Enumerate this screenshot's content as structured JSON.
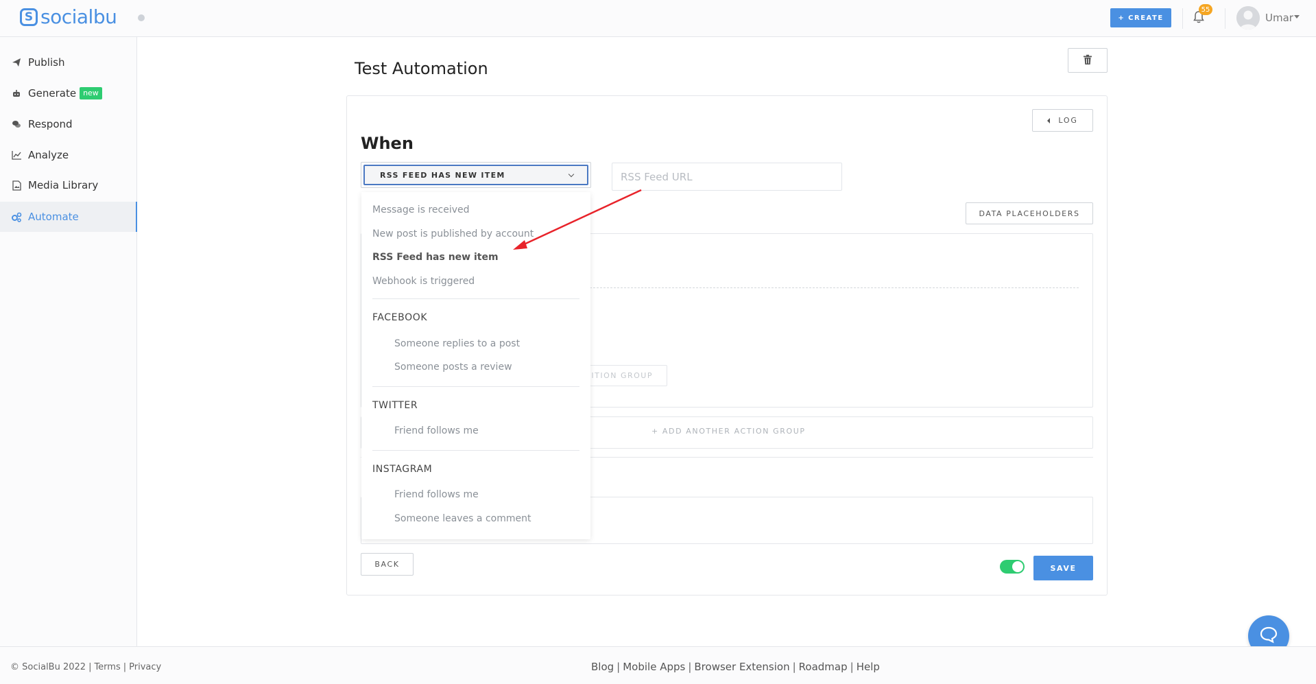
{
  "header": {
    "brand": "socialbu",
    "create_label": "+ CREATE",
    "notification_count": "55",
    "user_name": "Umar"
  },
  "sidebar": {
    "items": [
      {
        "label": "Publish",
        "icon": "paper-plane-icon"
      },
      {
        "label": "Generate",
        "icon": "robot-icon",
        "badge": "new"
      },
      {
        "label": "Respond",
        "icon": "chat-bubbles-icon"
      },
      {
        "label": "Analyze",
        "icon": "line-chart-icon"
      },
      {
        "label": "Media Library",
        "icon": "image-file-icon"
      },
      {
        "label": "Automate",
        "icon": "gears-icon",
        "active": true
      }
    ]
  },
  "main": {
    "title": "Test Automation",
    "log_label": "LOG",
    "when_title": "When",
    "trigger_selected": "RSS FEED HAS NEW ITEM",
    "rss_placeholder": "RSS Feed URL",
    "data_placeholders_label": "DATA PLACEHOLDERS",
    "condition_group_label": "ITION GROUP",
    "add_action_group_label": "+ ADD ANOTHER ACTION GROUP",
    "back_label": "BACK",
    "save_label": "SAVE",
    "toggle_on": true
  },
  "dropdown": {
    "general": [
      "Message is received",
      "New post is published by account",
      "RSS Feed has new item",
      "Webhook is triggered"
    ],
    "selected_index": 2,
    "facebook": {
      "heading": "FACEBOOK",
      "items": [
        "Someone replies to a post",
        "Someone posts a review"
      ]
    },
    "twitter": {
      "heading": "TWITTER",
      "items": [
        "Friend follows me"
      ]
    },
    "instagram": {
      "heading": "INSTAGRAM",
      "items": [
        "Friend follows me",
        "Someone leaves a comment"
      ]
    }
  },
  "footer": {
    "copyright": "© SocialBu 2022",
    "terms": "Terms",
    "privacy": "Privacy",
    "links": [
      "Blog",
      "Mobile Apps",
      "Browser Extension",
      "Roadmap",
      "Help"
    ]
  },
  "colors": {
    "accent": "#4a90e2",
    "success": "#2ecc71",
    "badge": "#f5a623",
    "annotation_arrow": "#e8232a"
  }
}
